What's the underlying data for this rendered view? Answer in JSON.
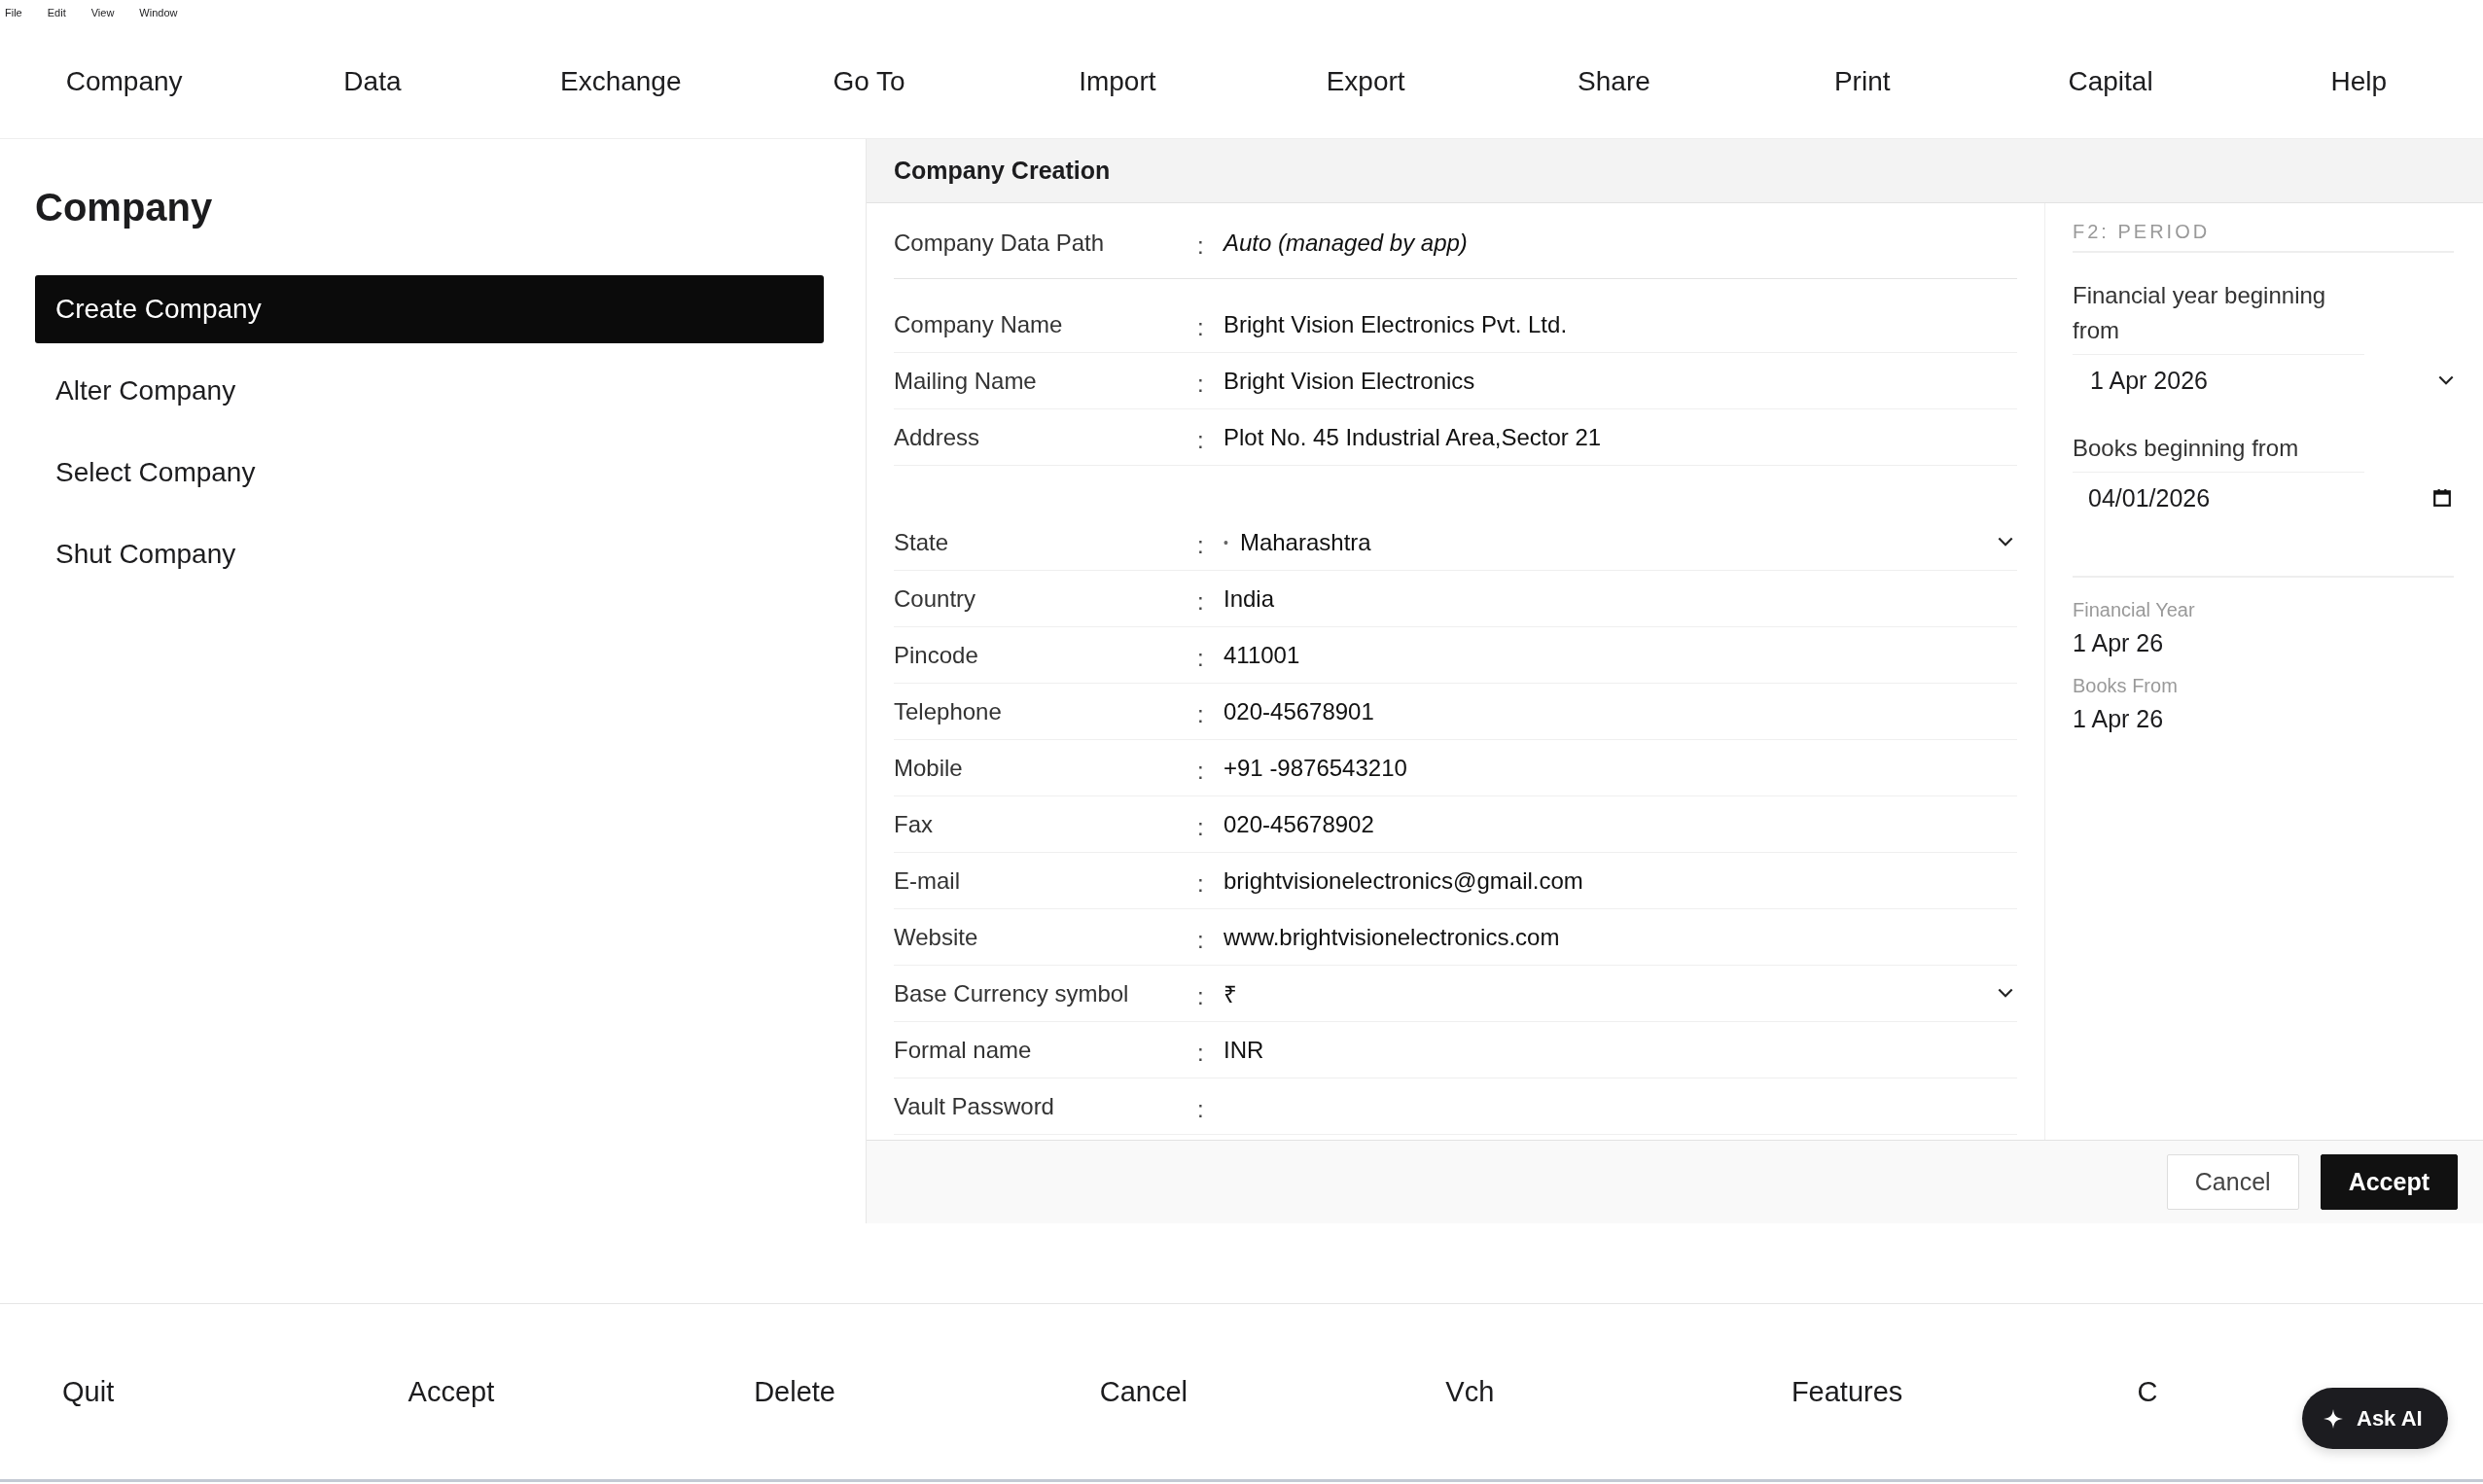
{
  "os_menu": [
    "File",
    "Edit",
    "View",
    "Window"
  ],
  "nav": [
    "Company",
    "Data",
    "Exchange",
    "Go To",
    "Import",
    "Export",
    "Share",
    "Print",
    "Capital",
    "Help"
  ],
  "sidebar": {
    "title": "Company",
    "items": [
      {
        "label": "Create Company",
        "selected": true
      },
      {
        "label": "Alter Company",
        "selected": false
      },
      {
        "label": "Select Company",
        "selected": false
      },
      {
        "label": "Shut Company",
        "selected": false
      }
    ]
  },
  "form": {
    "title": "Company Creation",
    "separator": ":",
    "sections": [
      [
        {
          "label": "Company Data Path",
          "kind": "auto",
          "placeholder": "Auto (managed by app)"
        }
      ],
      [
        {
          "label": "Company Name",
          "kind": "text",
          "value": "Bright Vision Electronics Pvt. Ltd."
        },
        {
          "label": "Mailing Name",
          "kind": "text",
          "value": "Bright Vision Electronics"
        },
        {
          "label": "Address",
          "kind": "text",
          "value": "Plot No. 45 Industrial Area,Sector 21"
        }
      ],
      [
        {
          "label": "State",
          "kind": "select",
          "prefix": "•",
          "value": "Maharashtra"
        },
        {
          "label": "Country",
          "kind": "text",
          "value": "India"
        },
        {
          "label": "Pincode",
          "kind": "text",
          "value": "411001"
        },
        {
          "label": "Telephone",
          "kind": "text",
          "value": "020-45678901"
        },
        {
          "label": "Mobile",
          "kind": "text",
          "value": "+91 -9876543210"
        },
        {
          "label": "Fax",
          "kind": "text",
          "value": "020-45678902"
        },
        {
          "label": "E-mail",
          "kind": "text",
          "value": "brightvisionelectronics@gmail.com"
        },
        {
          "label": "Website",
          "kind": "text",
          "value": "www.brightvisionelectronics.com"
        },
        {
          "label": "Base Currency symbol",
          "kind": "select",
          "value": "₹"
        },
        {
          "label": "Formal name",
          "kind": "text",
          "value": "INR"
        },
        {
          "label": "Vault Password",
          "kind": "password"
        }
      ]
    ]
  },
  "period": {
    "heading": "F2: PERIOD",
    "fields": [
      {
        "label": "Financial year beginning from",
        "kind": "select",
        "value": "1 Apr 2026"
      },
      {
        "label": "Books beginning from",
        "kind": "date",
        "value": "04/01/2026"
      }
    ],
    "summary": [
      {
        "label": "Financial Year",
        "value": "1 Apr 26"
      },
      {
        "label": "Books From",
        "value": "1 Apr 26"
      }
    ]
  },
  "actions": [
    "Cancel",
    "Accept"
  ],
  "bottom_bar": [
    "Quit",
    "Accept",
    "Delete",
    "Cancel",
    "Vch",
    "Features",
    "C"
  ],
  "ask_ai": "Ask AI"
}
